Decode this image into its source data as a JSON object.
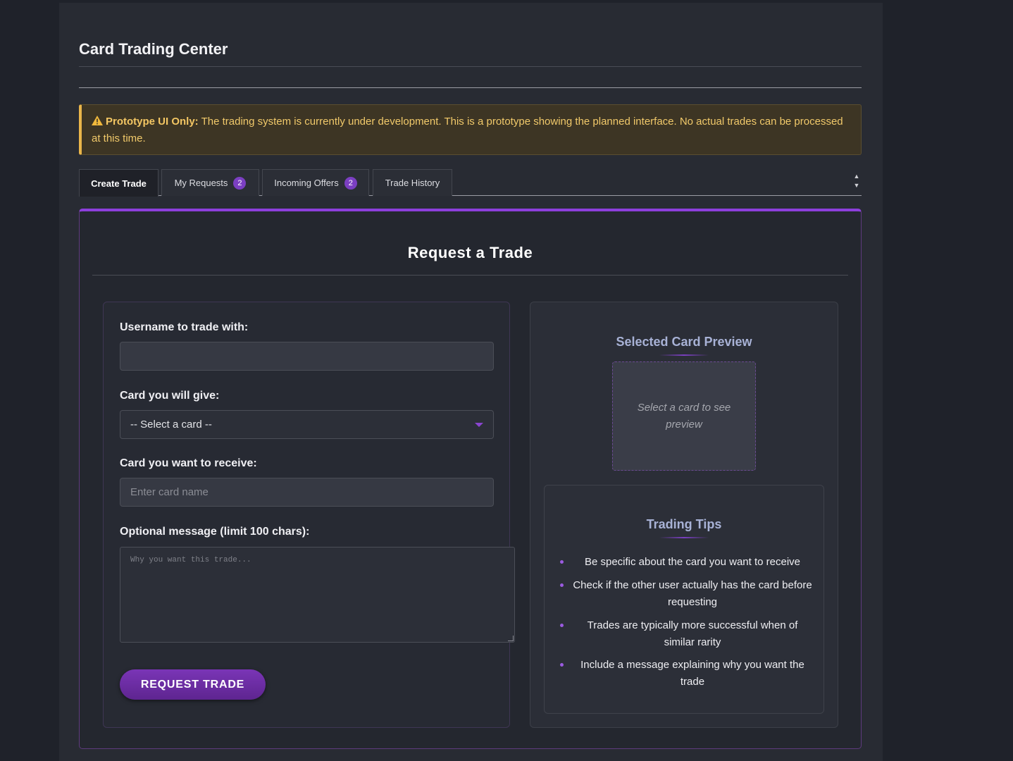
{
  "page": {
    "title": "Card Trading Center"
  },
  "alert": {
    "icon": "warning-icon",
    "label": "Prototype UI Only:",
    "text": " The trading system is currently under development. This is a prototype showing the planned interface. No actual trades can be processed at this time."
  },
  "tabs": [
    {
      "label": "Create Trade",
      "active": true
    },
    {
      "label": "My Requests",
      "badge": "2"
    },
    {
      "label": "Incoming Offers",
      "badge": "2"
    },
    {
      "label": "Trade History"
    }
  ],
  "form": {
    "title": "Request a Trade",
    "username_label": "Username to trade with:",
    "username_value": "",
    "give_label": "Card you will give:",
    "give_selected": "-- Select a card --",
    "receive_label": "Card you want to receive:",
    "receive_placeholder": "Enter card name",
    "message_label": "Optional message (limit 100 chars):",
    "message_placeholder": "Why you want this trade...",
    "submit_label": "REQUEST TRADE"
  },
  "preview": {
    "heading": "Selected Card Preview",
    "empty_text": "Select a card to see preview"
  },
  "tips": {
    "heading": "Trading Tips",
    "items": [
      "Be specific about the card you want to receive",
      "Check if the other user actually has the card before requesting",
      "Trades are typically more successful when of similar rarity",
      "Include a message explaining why you want the trade"
    ]
  },
  "colors": {
    "accent": "#8d3fdc",
    "warning": "#e9b54a",
    "heading": "#a8b2d6"
  }
}
